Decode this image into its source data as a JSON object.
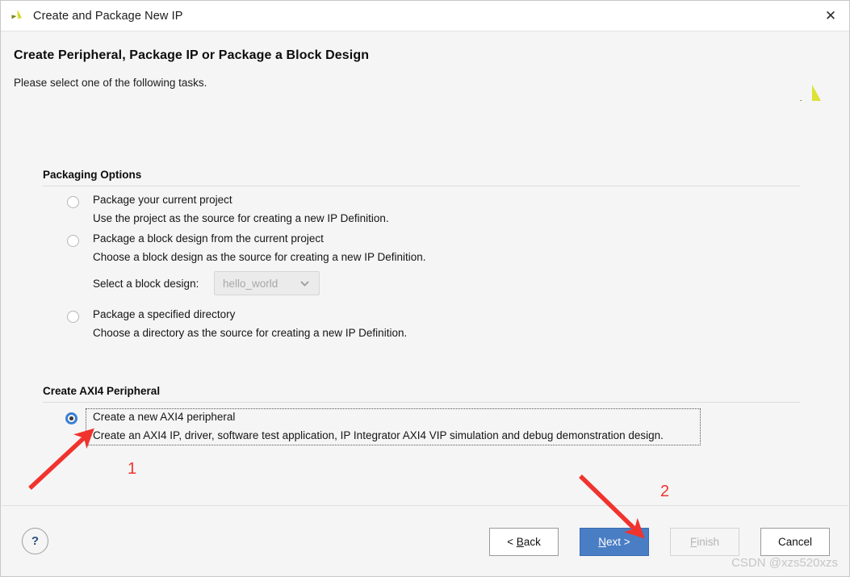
{
  "window": {
    "title": "Create and Package New IP",
    "app_icon": "vivado-logo-icon",
    "close_label": "✕"
  },
  "header": {
    "title": "Create Peripheral, Package IP or Package a Block Design",
    "subtitle": "Please select one of the following tasks.",
    "logo": "xilinx-pinwheel-logo"
  },
  "packaging_options": {
    "group_label": "Packaging Options",
    "options": [
      {
        "title": "Package your current project",
        "description": "Use the project as the source for creating a new IP Definition.",
        "selected": false
      },
      {
        "title": "Package a block design from the current project",
        "description": "Choose a block design as the source for creating a new IP Definition.",
        "selected": false
      },
      {
        "title": "Package a specified directory",
        "description": "Choose a directory as the source for creating a new IP Definition.",
        "selected": false
      }
    ],
    "block_design_select": {
      "label": "Select a block design:",
      "value": "hello_world",
      "enabled": false,
      "options": [
        "hello_world"
      ]
    }
  },
  "axi4_section": {
    "group_label": "Create AXI4 Peripheral",
    "option": {
      "title": "Create a new AXI4 peripheral",
      "description": "Create an AXI4 IP, driver, software test application, IP Integrator AXI4 VIP simulation and debug demonstration design.",
      "selected": true
    }
  },
  "footer": {
    "help_label": "?",
    "buttons": [
      {
        "label": "< Back",
        "mnemonic": "B",
        "state": "enabled"
      },
      {
        "label": "Next >",
        "mnemonic": "N",
        "state": "primary"
      },
      {
        "label": "Finish",
        "mnemonic": "F",
        "state": "disabled"
      },
      {
        "label": "Cancel",
        "mnemonic": "",
        "state": "enabled"
      }
    ]
  },
  "annotations": {
    "marker_color": "#f1332e",
    "items": [
      {
        "number": "1",
        "points_to": "axi4-radio-button"
      },
      {
        "number": "2",
        "points_to": "next-button"
      }
    ]
  },
  "watermark": {
    "text": "CSDN @xzs520xzs"
  },
  "colors": {
    "background": "#f5f5f5",
    "titlebar": "#ffffff",
    "accent_blue": "#4a7ec4",
    "radio_blue": "#3a7fd5",
    "annotation_red": "#f1332e"
  }
}
